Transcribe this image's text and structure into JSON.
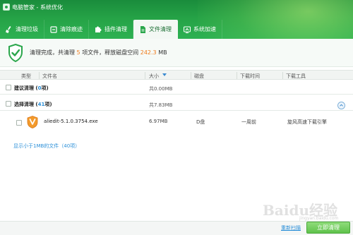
{
  "app": {
    "title": "电脑管家 - 系统优化"
  },
  "tabs": [
    {
      "label": "清理垃圾",
      "icon": "broom-icon",
      "active": false
    },
    {
      "label": "清除痕迹",
      "icon": "erase-icon",
      "active": false
    },
    {
      "label": "插件清理",
      "icon": "puzzle-icon",
      "active": false
    },
    {
      "label": "文件清理",
      "icon": "file-clean-icon",
      "active": true
    },
    {
      "label": "系统加速",
      "icon": "rocket-icon",
      "active": false
    }
  ],
  "summary": {
    "prefix": "清理完成，共清理",
    "count": "5",
    "middle": "项文件，释放磁盘空间",
    "size": "242.3",
    "unit": "MB"
  },
  "table": {
    "headers": {
      "type": "类型",
      "filename": "文件名",
      "size": "大小",
      "disk": "磁盘",
      "download_time": "下载时间",
      "download_tool": "下载工具"
    }
  },
  "groups": {
    "suggested": {
      "label_prefix": "建议清理 (",
      "count": "0",
      "label_suffix": "项)",
      "size": "共0.00MB"
    },
    "selected": {
      "label_prefix": "选择清理 (",
      "count": "41",
      "label_suffix": "项)",
      "size": "共7.83MB"
    }
  },
  "file": {
    "name": "aliedit-5.1.0.3754.exe",
    "size": "6.97MB",
    "disk": "D盘",
    "time": "一周前",
    "tool": "旋风高速下载引擎"
  },
  "more_link": "显示小于1MB的文件（40项）",
  "footer": {
    "rescan": "重新扫描",
    "clean": "立即清理"
  },
  "watermark": {
    "main": "Baidu经验",
    "sub": "jingyan.baidu.com"
  },
  "colors": {
    "brand_green": "#25a246",
    "accent_orange": "#f07a1a",
    "link_blue": "#2a8fd8"
  }
}
